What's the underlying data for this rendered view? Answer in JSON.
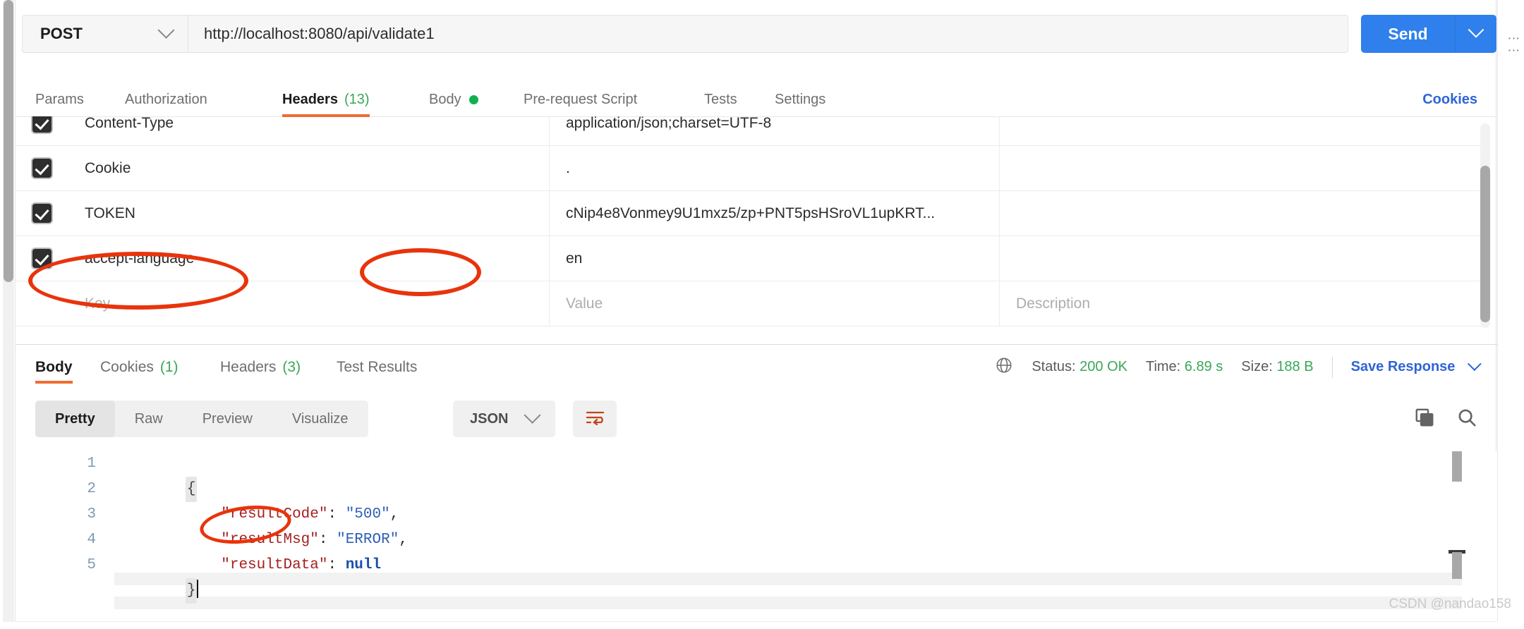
{
  "request": {
    "method": "POST",
    "method_icon": "chevron-down-icon",
    "url": "http://localhost:8080/api/validate1",
    "send_label": "Send",
    "send_caret_icon": "chevron-down-icon",
    "tabs": [
      {
        "label": "Params",
        "active": false,
        "count": "",
        "dot": false
      },
      {
        "label": "Authorization",
        "active": false,
        "count": "",
        "dot": false
      },
      {
        "label": "Headers",
        "active": true,
        "count": "(13)",
        "dot": false
      },
      {
        "label": "Body",
        "active": false,
        "count": "",
        "dot": true
      },
      {
        "label": "Pre-request Script",
        "active": false,
        "count": "",
        "dot": false
      },
      {
        "label": "Tests",
        "active": false,
        "count": "",
        "dot": false
      },
      {
        "label": "Settings",
        "active": false,
        "count": "",
        "dot": false
      }
    ],
    "cookies_link": "Cookies"
  },
  "headers_table": {
    "columns": [
      "Key",
      "Value",
      "Description"
    ],
    "placeholders": {
      "key": "Key",
      "value": "Value",
      "description": "Description"
    },
    "rows": [
      {
        "checked": true,
        "key": "Content-Type",
        "value": "application/json;charset=UTF-8",
        "description": ""
      },
      {
        "checked": true,
        "key": "Cookie",
        "value": ".",
        "description": ""
      },
      {
        "checked": true,
        "key": "TOKEN",
        "value": "cNip4e8Vonmey9U1mxz5/zp+PNT5psHSroVL1upKRT...",
        "description": ""
      },
      {
        "checked": true,
        "key": "accept-language",
        "value": "en",
        "description": ""
      }
    ]
  },
  "response": {
    "tabs": [
      {
        "label": "Body",
        "active": true,
        "count": ""
      },
      {
        "label": "Cookies",
        "active": false,
        "count": "(1)"
      },
      {
        "label": "Headers",
        "active": false,
        "count": "(3)"
      },
      {
        "label": "Test Results",
        "active": false,
        "count": ""
      }
    ],
    "globe_icon": "globe-icon",
    "status_label": "Status:",
    "status_value": "200 OK",
    "time_label": "Time:",
    "time_value": "6.89 s",
    "size_label": "Size:",
    "size_value": "188 B",
    "save_label": "Save Response",
    "save_caret_icon": "chevron-down-icon",
    "view_modes": [
      {
        "label": "Pretty",
        "active": true
      },
      {
        "label": "Raw",
        "active": false
      },
      {
        "label": "Preview",
        "active": false
      },
      {
        "label": "Visualize",
        "active": false
      }
    ],
    "format": "JSON",
    "format_caret_icon": "chevron-down-icon",
    "wrap_icon": "wrap-text-icon",
    "copy_icon": "copy-icon",
    "search_icon": "search-icon"
  },
  "code": {
    "line_numbers": [
      "1",
      "2",
      "3",
      "4",
      "5"
    ],
    "lines": [
      {
        "indent": 0,
        "parts": [
          {
            "t": "{",
            "c": "fold"
          }
        ]
      },
      {
        "indent": 1,
        "parts": [
          {
            "t": "\"resultCode\"",
            "c": "k"
          },
          {
            "t": ": ",
            "c": "p"
          },
          {
            "t": "\"500\"",
            "c": "s"
          },
          {
            "t": ",",
            "c": "p"
          }
        ]
      },
      {
        "indent": 1,
        "parts": [
          {
            "t": "\"resultMsg\"",
            "c": "k"
          },
          {
            "t": ": ",
            "c": "p"
          },
          {
            "t": "\"ERROR\"",
            "c": "s"
          },
          {
            "t": ",",
            "c": "p"
          }
        ]
      },
      {
        "indent": 1,
        "parts": [
          {
            "t": "\"resultData\"",
            "c": "k"
          },
          {
            "t": ": ",
            "c": "p"
          },
          {
            "t": "null",
            "c": "n"
          }
        ]
      },
      {
        "indent": 0,
        "parts": [
          {
            "t": "}",
            "c": "fold"
          }
        ]
      }
    ],
    "raw_json": {
      "resultCode": "500",
      "resultMsg": "ERROR",
      "resultData": null
    }
  },
  "annotations": {
    "color": "#e8340c",
    "circles": [
      {
        "target": "accept-language-key"
      },
      {
        "target": "accept-language-value"
      },
      {
        "target": "result-msg-error-string"
      }
    ]
  },
  "watermark": "CSDN @nandao158"
}
